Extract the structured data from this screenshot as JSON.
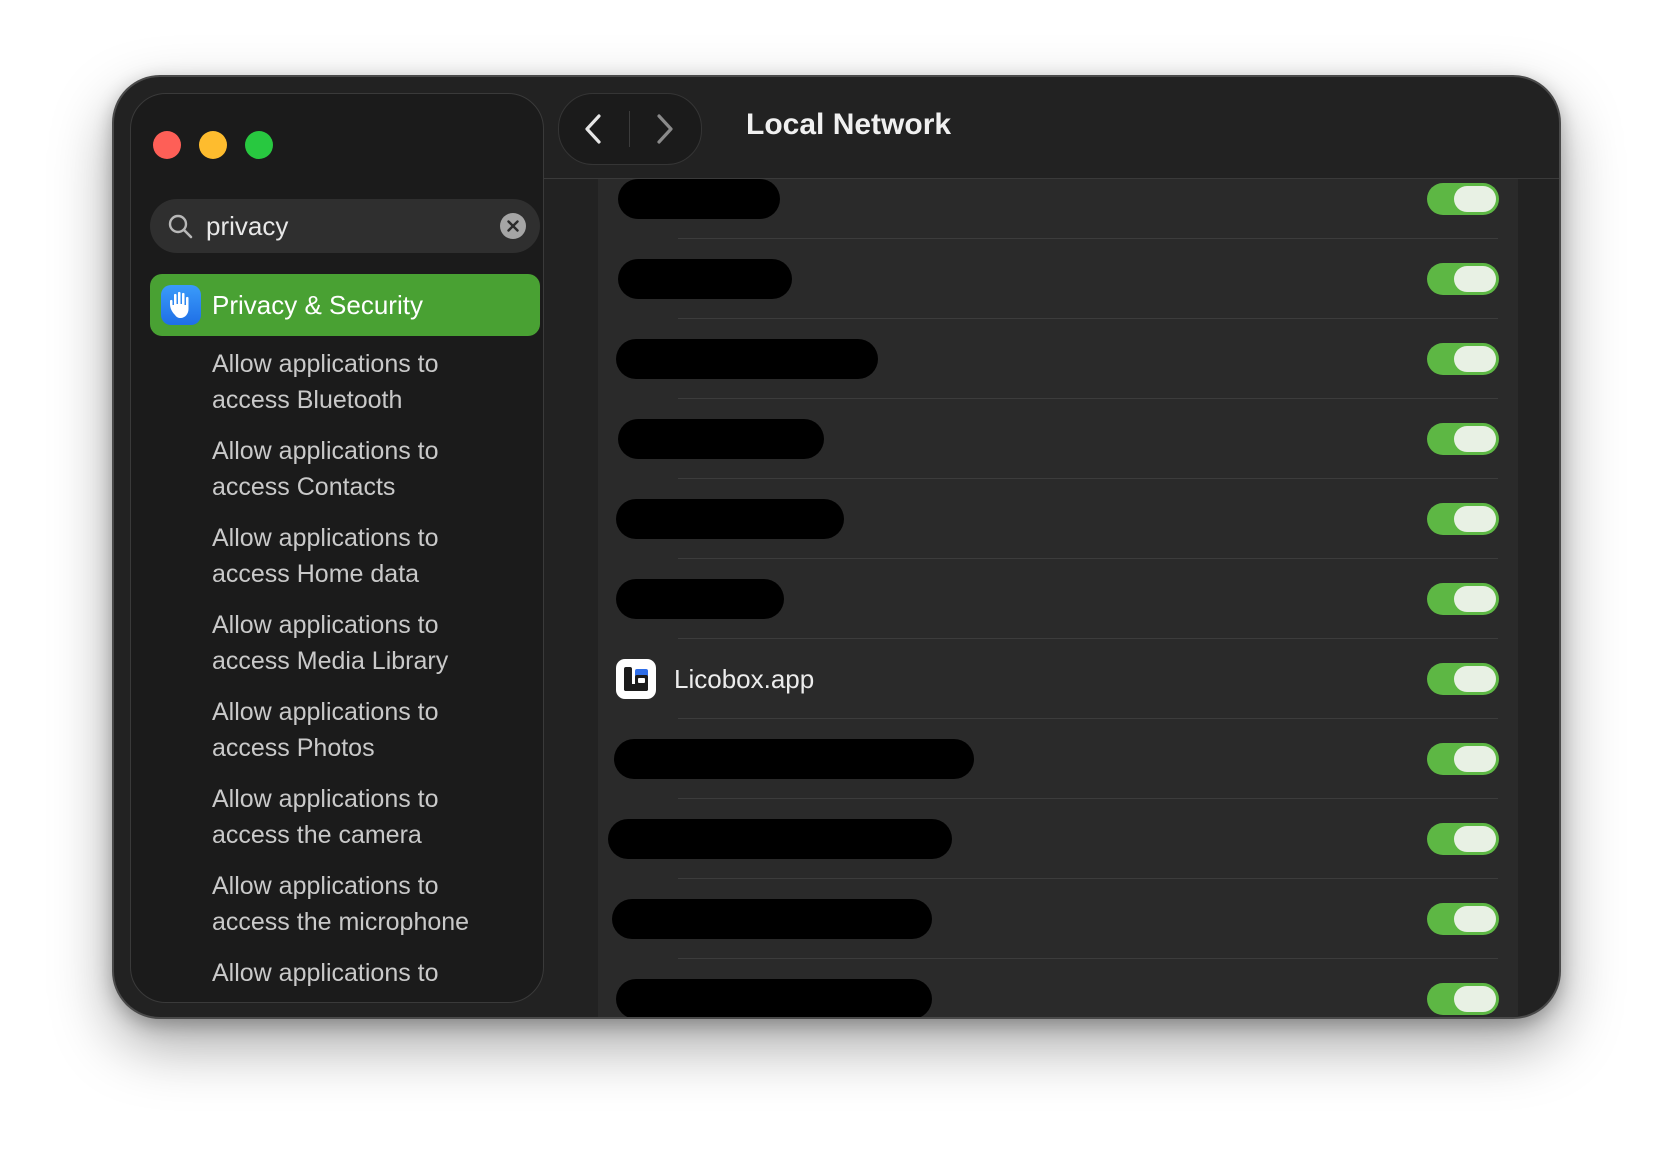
{
  "window": {
    "controls": [
      "close",
      "minimize",
      "zoom"
    ]
  },
  "search": {
    "query": "privacy",
    "icon": "magnifying-glass-icon",
    "clear_icon": "clear-icon"
  },
  "sidebar": {
    "selected": {
      "label": "Privacy & Security",
      "icon": "hand-raised-icon"
    },
    "sub_items": [
      "Allow applications to\naccess Bluetooth",
      "Allow applications to\naccess Contacts",
      "Allow applications to\naccess Home data",
      "Allow applications to\naccess Media Library",
      "Allow applications to\naccess Photos",
      "Allow applications to\naccess the camera",
      "Allow applications to\naccess the microphone",
      "Allow applications to"
    ]
  },
  "toolbar": {
    "title": "Local Network",
    "back_icon": "chevron-left-icon",
    "forward_icon": "chevron-right-icon"
  },
  "apps": [
    {
      "name": null,
      "redacted": true,
      "enabled": true
    },
    {
      "name": null,
      "redacted": true,
      "enabled": true
    },
    {
      "name": null,
      "redacted": true,
      "enabled": true
    },
    {
      "name": null,
      "redacted": true,
      "enabled": true
    },
    {
      "name": null,
      "redacted": true,
      "enabled": true
    },
    {
      "name": null,
      "redacted": true,
      "enabled": true
    },
    {
      "name": "Licobox.app",
      "redacted": false,
      "enabled": true
    },
    {
      "name": null,
      "redacted": true,
      "enabled": true
    },
    {
      "name": null,
      "redacted": true,
      "enabled": true
    },
    {
      "name": null,
      "redacted": true,
      "enabled": true
    },
    {
      "name": null,
      "redacted": true,
      "enabled": true
    }
  ],
  "colors": {
    "accent_green": "#49a133",
    "toggle_on": "#5db744",
    "close": "#fe5f57",
    "minimize": "#febc2e",
    "zoom": "#28c840"
  }
}
